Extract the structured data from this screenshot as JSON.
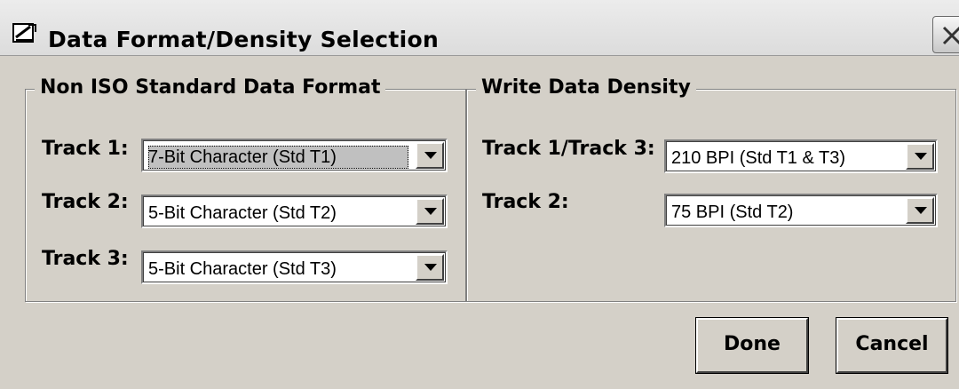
{
  "window": {
    "title": "Data Format/Density Selection"
  },
  "format_group": {
    "legend": "Non ISO Standard Data Format",
    "rows": [
      {
        "label": "Track 1:",
        "value": "7-Bit Character (Std T1)"
      },
      {
        "label": "Track 2:",
        "value": "5-Bit Character (Std T2)"
      },
      {
        "label": "Track 3:",
        "value": "5-Bit Character (Std T3)"
      }
    ]
  },
  "density_group": {
    "legend": "Write Data Density",
    "rows": [
      {
        "label": "Track 1/Track 3:",
        "value": "210 BPI (Std T1 & T3)"
      },
      {
        "label": "Track 2:",
        "value": "75 BPI (Std T2)"
      }
    ]
  },
  "buttons": {
    "done": "Done",
    "cancel": "Cancel"
  },
  "icons": {
    "app": "app-icon",
    "close": "close-icon",
    "dropdown": "chevron-down-icon"
  },
  "colors": {
    "face": "#d4d0c8",
    "field": "#ffffff",
    "focus": "#c0c0c0"
  }
}
